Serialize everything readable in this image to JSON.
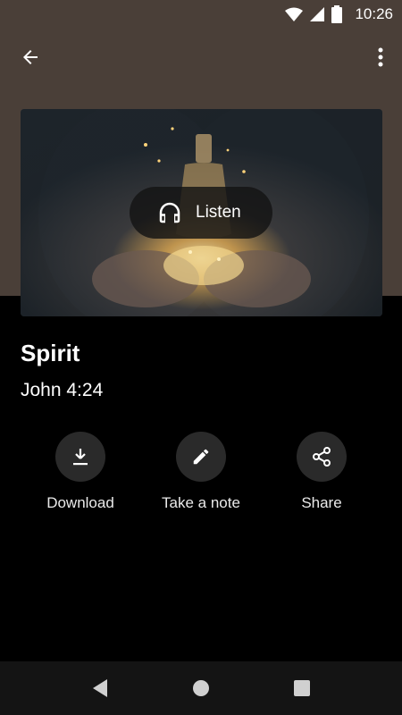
{
  "status_bar": {
    "time": "10:26",
    "icons": [
      "wifi-icon",
      "cell-signal-icon",
      "battery-icon"
    ]
  },
  "appbar": {
    "back_icon": "arrow-back-icon",
    "menu_icon": "more-vert-icon"
  },
  "hero": {
    "listen_label": "Listen",
    "listen_icon": "headphones-icon"
  },
  "content": {
    "title": "Spirit",
    "reference": "John 4:24"
  },
  "actions": [
    {
      "label": "Download",
      "icon": "download-icon"
    },
    {
      "label": "Take a note",
      "icon": "pencil-icon"
    },
    {
      "label": "Share",
      "icon": "share-icon"
    }
  ],
  "colors": {
    "header_bg": "#4a3f38",
    "background": "#000000",
    "action_circle": "#2a2a2a",
    "nav_bar": "#141414"
  }
}
